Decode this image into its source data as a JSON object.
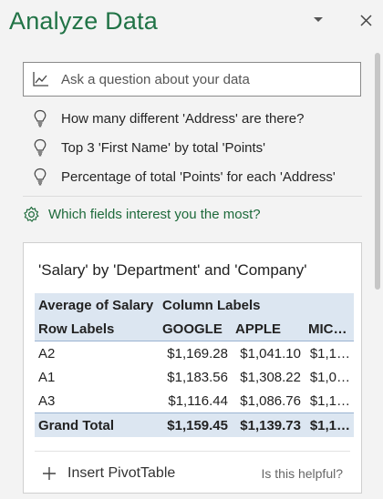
{
  "pane": {
    "title": "Analyze Data"
  },
  "search": {
    "placeholder": "Ask a question about your data",
    "value": ""
  },
  "suggestions": [
    {
      "label": "How many different 'Address' are there?"
    },
    {
      "label": "Top 3 'First Name' by total 'Points'"
    },
    {
      "label": "Percentage of total 'Points' for each 'Address'"
    }
  ],
  "fields_link": {
    "label": "Which fields interest you the most?"
  },
  "card": {
    "title": "'Salary' by 'Department' and 'Company'",
    "pivot": {
      "header1": {
        "a": "Average of Salary",
        "b": "Column Labels"
      },
      "header2": {
        "a": "Row Labels",
        "c1": "GOOGLE",
        "c2": "APPLE",
        "c3": "MIC…"
      },
      "rows": [
        {
          "label": "A2",
          "c1": "$1,169.28",
          "c2": "$1,041.10",
          "c3": "$1,1…"
        },
        {
          "label": "A1",
          "c1": "$1,183.56",
          "c2": "$1,308.22",
          "c3": "$1,0…"
        },
        {
          "label": "A3",
          "c1": "$1,116.44",
          "c2": "$1,086.76",
          "c3": "$1,1…"
        }
      ],
      "total": {
        "label": "Grand Total",
        "c1": "$1,159.45",
        "c2": "$1,139.73",
        "c3": "$1,1…"
      }
    },
    "insert_label": "Insert PivotTable",
    "helpful_label": "Is this helpful?"
  },
  "colors": {
    "accent": "#217346",
    "link": "#1e6a3b",
    "pivot_header": "#dce6f1"
  },
  "icons": {
    "header": [
      "chevron-down-icon",
      "close-icon"
    ],
    "search": "chart-line-icon",
    "suggestion": "lightbulb-icon",
    "fields": "gear-icon",
    "insert": "plus-icon"
  }
}
